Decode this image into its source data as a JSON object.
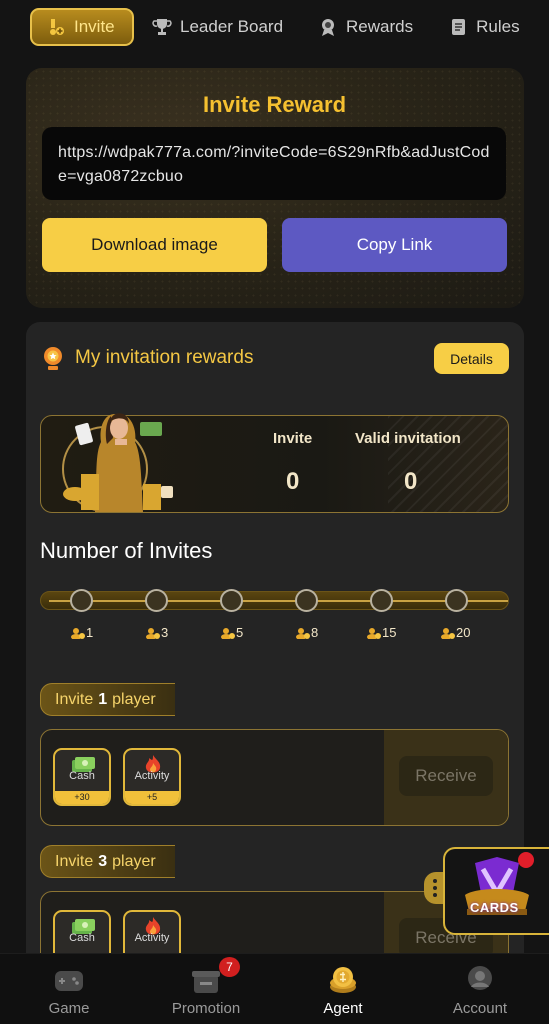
{
  "tabs": [
    {
      "label": "Invite",
      "icon": "invite-icon",
      "active": true
    },
    {
      "label": "Leader Board",
      "icon": "trophy-icon",
      "active": false
    },
    {
      "label": "Rewards",
      "icon": "reward-icon",
      "active": false
    },
    {
      "label": "Rules",
      "icon": "rules-icon",
      "active": false
    }
  ],
  "invite_reward": {
    "title": "Invite Reward",
    "link": "https://wdpak777a.com/?inviteCode=6S29nRfb&adJustCode=vga0872zcbuo",
    "download_label": "Download image",
    "copy_label": "Copy Link"
  },
  "my_rewards": {
    "title": "My invitation rewards",
    "details_label": "Details",
    "invite_label": "Invite",
    "invite_value": "0",
    "valid_label": "Valid invitation",
    "valid_value": "0"
  },
  "invites_progress": {
    "title": "Number of Invites",
    "milestones": [
      "1",
      "3",
      "5",
      "8",
      "15",
      "20"
    ],
    "progress_fraction": 0
  },
  "tiers": [
    {
      "prefix": "Invite",
      "count": "1",
      "suffix": "player",
      "rewards": [
        {
          "label": "Cash",
          "amount": "+30",
          "icon": "cash-icon"
        },
        {
          "label": "Activity",
          "amount": "+5",
          "icon": "fire-icon"
        }
      ],
      "receive_label": "Receive"
    },
    {
      "prefix": "Invite",
      "count": "3",
      "suffix": "player",
      "rewards": [
        {
          "label": "Cash",
          "icon": "cash-icon"
        },
        {
          "label": "Activity",
          "icon": "fire-icon"
        }
      ],
      "receive_label": "Receive"
    }
  ],
  "cards_widget": {
    "label": "CARDS"
  },
  "bottom_nav": [
    {
      "label": "Game",
      "icon": "gamepad-icon",
      "active": false
    },
    {
      "label": "Promotion",
      "icon": "gift-icon",
      "active": false,
      "badge": "7"
    },
    {
      "label": "Agent",
      "icon": "coin-stack-icon",
      "active": true
    },
    {
      "label": "Account",
      "icon": "user-icon",
      "active": false
    }
  ],
  "colors": {
    "accent": "#f7ce45",
    "copy_button": "#5d59c2",
    "gold_text": "#f4c744",
    "badge": "#d11f1f"
  }
}
